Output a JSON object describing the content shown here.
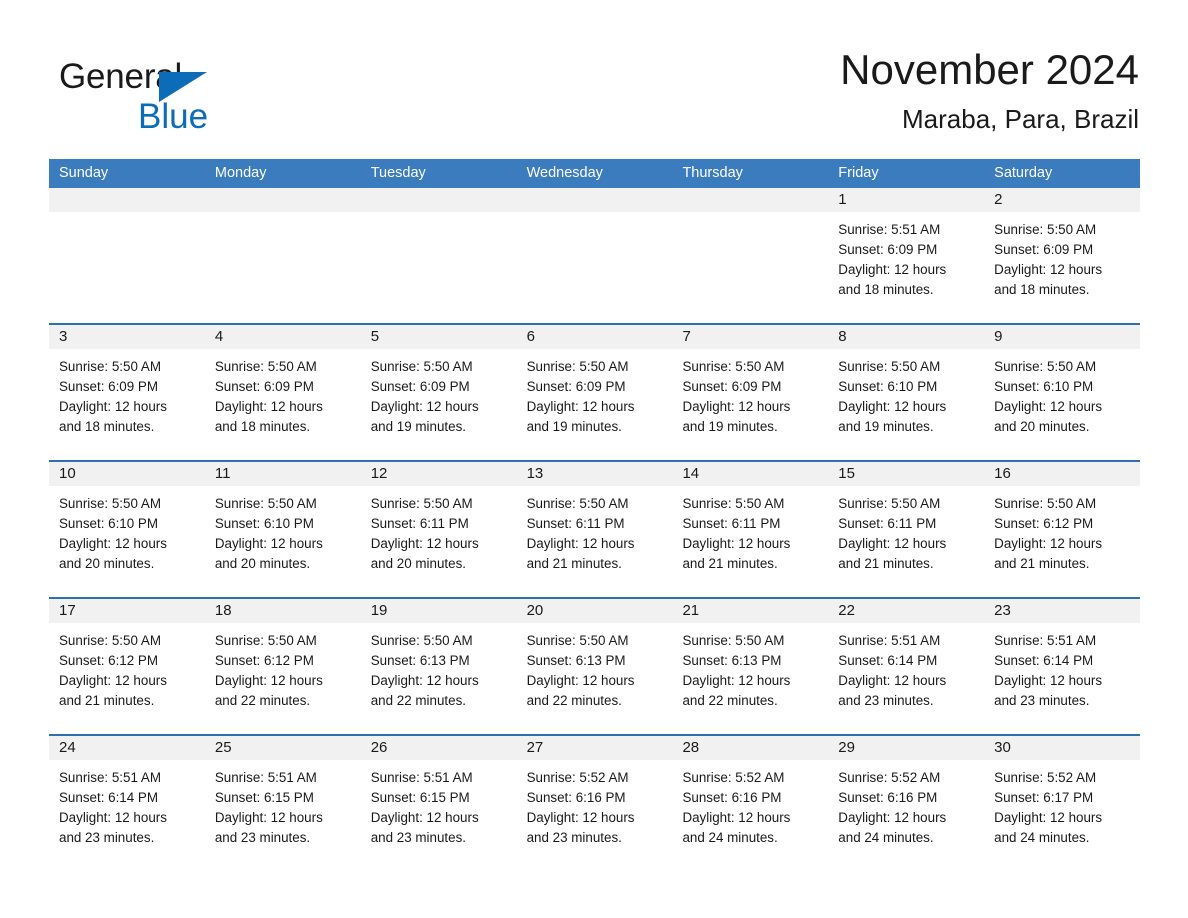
{
  "brand": {
    "name_first": "General",
    "name_second": "Blue",
    "logo_icon": "blue-triangle-logo",
    "accent_color": "#0b6cb7"
  },
  "header": {
    "title": "November 2024",
    "location": "Maraba, Para, Brazil"
  },
  "colors": {
    "header_blue": "#3a7cbd",
    "row_divider_blue": "#2f6fad",
    "day_band_gray": "#f1f1f1",
    "text": "#1a1a1a"
  },
  "weekdays": [
    "Sunday",
    "Monday",
    "Tuesday",
    "Wednesday",
    "Thursday",
    "Friday",
    "Saturday"
  ],
  "weeks": [
    [
      {
        "day": "",
        "sunrise": "",
        "sunset": "",
        "daylight_line1": "",
        "daylight_line2": ""
      },
      {
        "day": "",
        "sunrise": "",
        "sunset": "",
        "daylight_line1": "",
        "daylight_line2": ""
      },
      {
        "day": "",
        "sunrise": "",
        "sunset": "",
        "daylight_line1": "",
        "daylight_line2": ""
      },
      {
        "day": "",
        "sunrise": "",
        "sunset": "",
        "daylight_line1": "",
        "daylight_line2": ""
      },
      {
        "day": "",
        "sunrise": "",
        "sunset": "",
        "daylight_line1": "",
        "daylight_line2": ""
      },
      {
        "day": "1",
        "sunrise": "Sunrise: 5:51 AM",
        "sunset": "Sunset: 6:09 PM",
        "daylight_line1": "Daylight: 12 hours",
        "daylight_line2": "and 18 minutes."
      },
      {
        "day": "2",
        "sunrise": "Sunrise: 5:50 AM",
        "sunset": "Sunset: 6:09 PM",
        "daylight_line1": "Daylight: 12 hours",
        "daylight_line2": "and 18 minutes."
      }
    ],
    [
      {
        "day": "3",
        "sunrise": "Sunrise: 5:50 AM",
        "sunset": "Sunset: 6:09 PM",
        "daylight_line1": "Daylight: 12 hours",
        "daylight_line2": "and 18 minutes."
      },
      {
        "day": "4",
        "sunrise": "Sunrise: 5:50 AM",
        "sunset": "Sunset: 6:09 PM",
        "daylight_line1": "Daylight: 12 hours",
        "daylight_line2": "and 18 minutes."
      },
      {
        "day": "5",
        "sunrise": "Sunrise: 5:50 AM",
        "sunset": "Sunset: 6:09 PM",
        "daylight_line1": "Daylight: 12 hours",
        "daylight_line2": "and 19 minutes."
      },
      {
        "day": "6",
        "sunrise": "Sunrise: 5:50 AM",
        "sunset": "Sunset: 6:09 PM",
        "daylight_line1": "Daylight: 12 hours",
        "daylight_line2": "and 19 minutes."
      },
      {
        "day": "7",
        "sunrise": "Sunrise: 5:50 AM",
        "sunset": "Sunset: 6:09 PM",
        "daylight_line1": "Daylight: 12 hours",
        "daylight_line2": "and 19 minutes."
      },
      {
        "day": "8",
        "sunrise": "Sunrise: 5:50 AM",
        "sunset": "Sunset: 6:10 PM",
        "daylight_line1": "Daylight: 12 hours",
        "daylight_line2": "and 19 minutes."
      },
      {
        "day": "9",
        "sunrise": "Sunrise: 5:50 AM",
        "sunset": "Sunset: 6:10 PM",
        "daylight_line1": "Daylight: 12 hours",
        "daylight_line2": "and 20 minutes."
      }
    ],
    [
      {
        "day": "10",
        "sunrise": "Sunrise: 5:50 AM",
        "sunset": "Sunset: 6:10 PM",
        "daylight_line1": "Daylight: 12 hours",
        "daylight_line2": "and 20 minutes."
      },
      {
        "day": "11",
        "sunrise": "Sunrise: 5:50 AM",
        "sunset": "Sunset: 6:10 PM",
        "daylight_line1": "Daylight: 12 hours",
        "daylight_line2": "and 20 minutes."
      },
      {
        "day": "12",
        "sunrise": "Sunrise: 5:50 AM",
        "sunset": "Sunset: 6:11 PM",
        "daylight_line1": "Daylight: 12 hours",
        "daylight_line2": "and 20 minutes."
      },
      {
        "day": "13",
        "sunrise": "Sunrise: 5:50 AM",
        "sunset": "Sunset: 6:11 PM",
        "daylight_line1": "Daylight: 12 hours",
        "daylight_line2": "and 21 minutes."
      },
      {
        "day": "14",
        "sunrise": "Sunrise: 5:50 AM",
        "sunset": "Sunset: 6:11 PM",
        "daylight_line1": "Daylight: 12 hours",
        "daylight_line2": "and 21 minutes."
      },
      {
        "day": "15",
        "sunrise": "Sunrise: 5:50 AM",
        "sunset": "Sunset: 6:11 PM",
        "daylight_line1": "Daylight: 12 hours",
        "daylight_line2": "and 21 minutes."
      },
      {
        "day": "16",
        "sunrise": "Sunrise: 5:50 AM",
        "sunset": "Sunset: 6:12 PM",
        "daylight_line1": "Daylight: 12 hours",
        "daylight_line2": "and 21 minutes."
      }
    ],
    [
      {
        "day": "17",
        "sunrise": "Sunrise: 5:50 AM",
        "sunset": "Sunset: 6:12 PM",
        "daylight_line1": "Daylight: 12 hours",
        "daylight_line2": "and 21 minutes."
      },
      {
        "day": "18",
        "sunrise": "Sunrise: 5:50 AM",
        "sunset": "Sunset: 6:12 PM",
        "daylight_line1": "Daylight: 12 hours",
        "daylight_line2": "and 22 minutes."
      },
      {
        "day": "19",
        "sunrise": "Sunrise: 5:50 AM",
        "sunset": "Sunset: 6:13 PM",
        "daylight_line1": "Daylight: 12 hours",
        "daylight_line2": "and 22 minutes."
      },
      {
        "day": "20",
        "sunrise": "Sunrise: 5:50 AM",
        "sunset": "Sunset: 6:13 PM",
        "daylight_line1": "Daylight: 12 hours",
        "daylight_line2": "and 22 minutes."
      },
      {
        "day": "21",
        "sunrise": "Sunrise: 5:50 AM",
        "sunset": "Sunset: 6:13 PM",
        "daylight_line1": "Daylight: 12 hours",
        "daylight_line2": "and 22 minutes."
      },
      {
        "day": "22",
        "sunrise": "Sunrise: 5:51 AM",
        "sunset": "Sunset: 6:14 PM",
        "daylight_line1": "Daylight: 12 hours",
        "daylight_line2": "and 23 minutes."
      },
      {
        "day": "23",
        "sunrise": "Sunrise: 5:51 AM",
        "sunset": "Sunset: 6:14 PM",
        "daylight_line1": "Daylight: 12 hours",
        "daylight_line2": "and 23 minutes."
      }
    ],
    [
      {
        "day": "24",
        "sunrise": "Sunrise: 5:51 AM",
        "sunset": "Sunset: 6:14 PM",
        "daylight_line1": "Daylight: 12 hours",
        "daylight_line2": "and 23 minutes."
      },
      {
        "day": "25",
        "sunrise": "Sunrise: 5:51 AM",
        "sunset": "Sunset: 6:15 PM",
        "daylight_line1": "Daylight: 12 hours",
        "daylight_line2": "and 23 minutes."
      },
      {
        "day": "26",
        "sunrise": "Sunrise: 5:51 AM",
        "sunset": "Sunset: 6:15 PM",
        "daylight_line1": "Daylight: 12 hours",
        "daylight_line2": "and 23 minutes."
      },
      {
        "day": "27",
        "sunrise": "Sunrise: 5:52 AM",
        "sunset": "Sunset: 6:16 PM",
        "daylight_line1": "Daylight: 12 hours",
        "daylight_line2": "and 23 minutes."
      },
      {
        "day": "28",
        "sunrise": "Sunrise: 5:52 AM",
        "sunset": "Sunset: 6:16 PM",
        "daylight_line1": "Daylight: 12 hours",
        "daylight_line2": "and 24 minutes."
      },
      {
        "day": "29",
        "sunrise": "Sunrise: 5:52 AM",
        "sunset": "Sunset: 6:16 PM",
        "daylight_line1": "Daylight: 12 hours",
        "daylight_line2": "and 24 minutes."
      },
      {
        "day": "30",
        "sunrise": "Sunrise: 5:52 AM",
        "sunset": "Sunset: 6:17 PM",
        "daylight_line1": "Daylight: 12 hours",
        "daylight_line2": "and 24 minutes."
      }
    ]
  ]
}
